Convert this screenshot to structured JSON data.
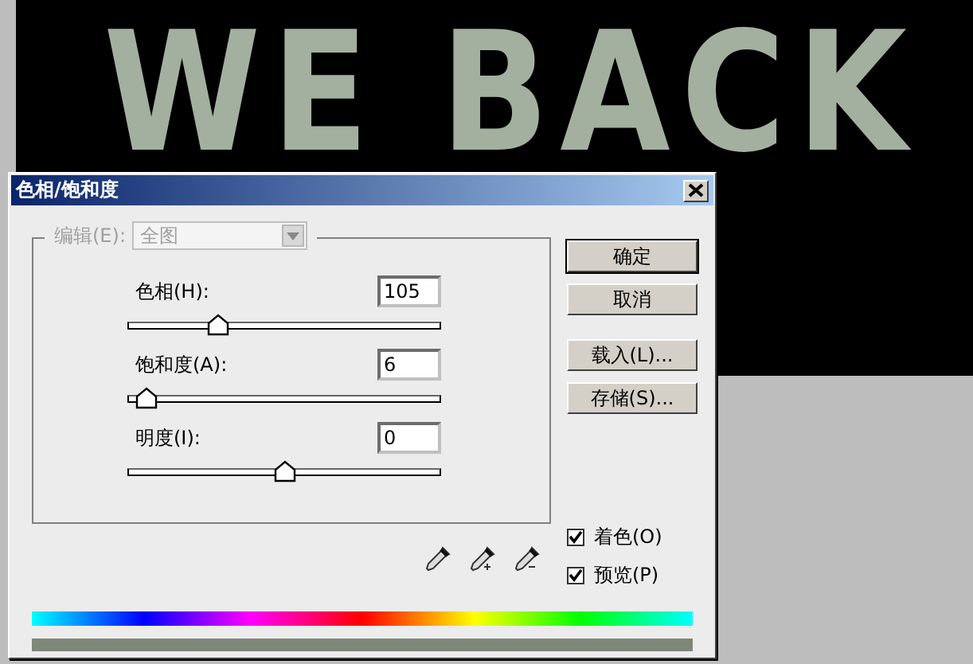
{
  "canvas": {
    "text": "WE BACK"
  },
  "dialog": {
    "title": "色相/饱和度",
    "edit": {
      "label": "编辑(E):",
      "value": "全图",
      "disabled": true
    },
    "sliders": [
      {
        "label": "色相(H):",
        "value": "105",
        "level": 0.29
      },
      {
        "label": "饱和度(A):",
        "value": "6",
        "level": 0.06
      },
      {
        "label": "明度(I):",
        "value": "0",
        "level": 0.5
      }
    ],
    "buttons": [
      {
        "label": "确定",
        "default": true
      },
      {
        "label": "取消",
        "default": false
      },
      {
        "label": "载入(L)...",
        "default": false
      },
      {
        "label": "存储(S)...",
        "default": false
      }
    ],
    "checkboxes": [
      {
        "label": "着色(O)",
        "checked": true
      },
      {
        "label": "预览(P)",
        "checked": true
      }
    ]
  }
}
